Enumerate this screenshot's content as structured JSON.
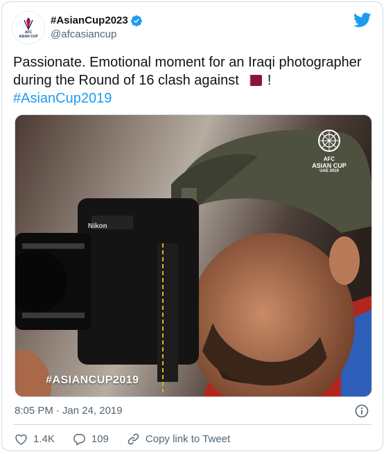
{
  "tweet": {
    "display_name": "#AsianCup2023",
    "handle": "@afcasiancup",
    "avatar_text": "AFC\nASIAN CUP",
    "text_part1": "Passionate. Emotional moment for an Iraqi photographer during the Round of 16 clash against",
    "text_part2": " !",
    "hashtag": "#AsianCup2019",
    "image_overlay_tag": "#ASIANCUP2019",
    "image_logo": {
      "line1": "AFC",
      "line2": "ASIAN CUP",
      "line3": "UAE 2019"
    },
    "camera_brand": "Nikon",
    "time": "8:05 PM",
    "separator": "·",
    "date": "Jan 24, 2019",
    "likes": "1.4K",
    "replies": "109",
    "copy_link_label": "Copy link to Tweet"
  },
  "colors": {
    "accent": "#1d9bf0",
    "text_primary": "#0f1419",
    "text_secondary": "#536471",
    "border": "#cfd9de",
    "qatar_maroon": "#8a1538"
  },
  "icons": [
    "verified-badge-icon",
    "twitter-bird-icon",
    "qatar-flag-icon",
    "info-icon",
    "heart-icon",
    "reply-icon",
    "link-icon"
  ]
}
